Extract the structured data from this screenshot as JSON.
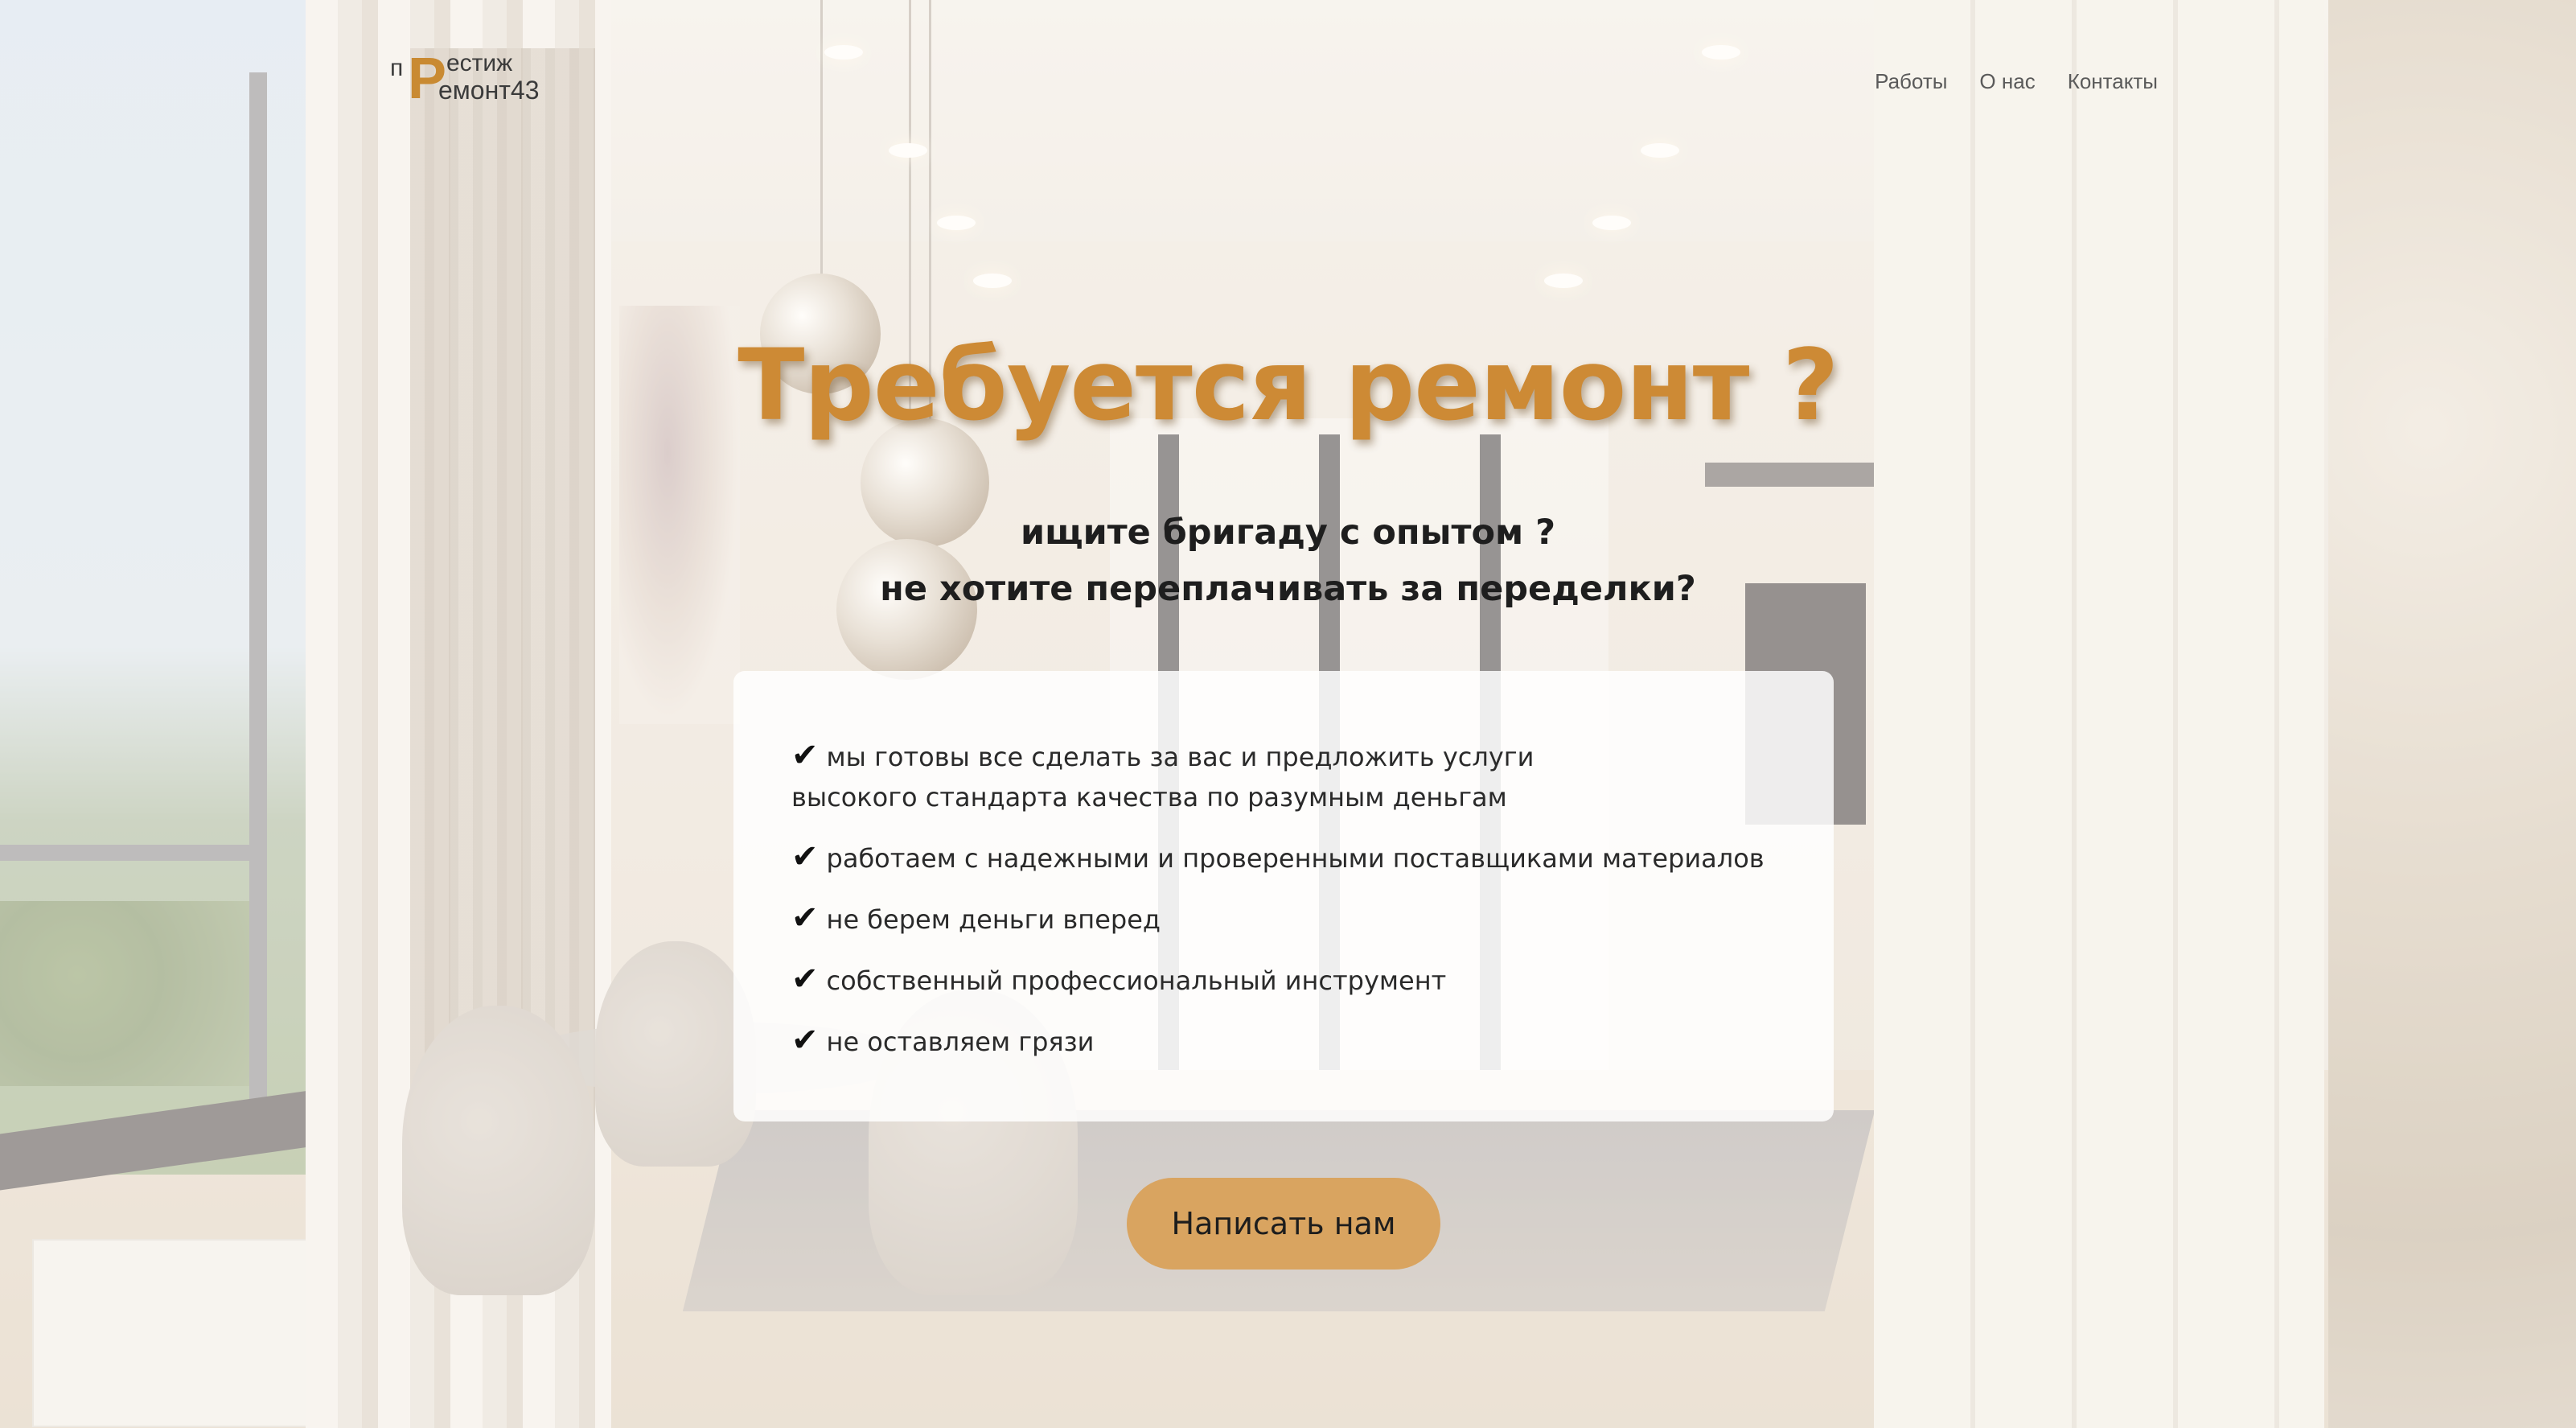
{
  "header": {
    "logo": {
      "small_letter": "п",
      "big_letter": "Р",
      "line1": "естиж",
      "line2": "емонт43"
    },
    "nav": [
      {
        "label": "Работы"
      },
      {
        "label": "О нас"
      },
      {
        "label": "Контакты"
      }
    ]
  },
  "hero": {
    "title": "Требуется ремонт ?",
    "subtitle_line1": "ищите бригаду с опытом ?",
    "subtitle_line2": "не хотите переплачивать за переделки?",
    "features": [
      {
        "check": "✔",
        "text": "мы готовы все сделать за вас и предложить услуги высокого стандарта качества по разумным деньгам"
      },
      {
        "check": "✔",
        "text": "работаем с надежными и проверенными поставщиками материалов"
      },
      {
        "check": "✔",
        "text": "не берем деньги вперед"
      },
      {
        "check": "✔",
        "text": "собственный профессиональный инструмент"
      },
      {
        "check": "✔",
        "text": "не оставляем грязи"
      }
    ],
    "cta_label": "Написать нам"
  },
  "colors": {
    "accent": "#cd8a35",
    "button": "#d9a460",
    "text": "#1e1e1e"
  }
}
